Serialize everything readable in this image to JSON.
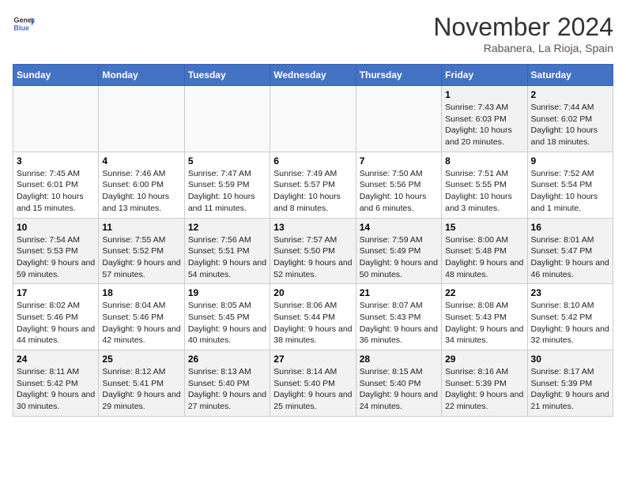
{
  "header": {
    "logo_line1": "General",
    "logo_line2": "Blue",
    "month": "November 2024",
    "location": "Rabanera, La Rioja, Spain"
  },
  "weekdays": [
    "Sunday",
    "Monday",
    "Tuesday",
    "Wednesday",
    "Thursday",
    "Friday",
    "Saturday"
  ],
  "weeks": [
    [
      {
        "day": "",
        "info": ""
      },
      {
        "day": "",
        "info": ""
      },
      {
        "day": "",
        "info": ""
      },
      {
        "day": "",
        "info": ""
      },
      {
        "day": "",
        "info": ""
      },
      {
        "day": "1",
        "info": "Sunrise: 7:43 AM\nSunset: 6:03 PM\nDaylight: 10 hours and 20 minutes."
      },
      {
        "day": "2",
        "info": "Sunrise: 7:44 AM\nSunset: 6:02 PM\nDaylight: 10 hours and 18 minutes."
      }
    ],
    [
      {
        "day": "3",
        "info": "Sunrise: 7:45 AM\nSunset: 6:01 PM\nDaylight: 10 hours and 15 minutes."
      },
      {
        "day": "4",
        "info": "Sunrise: 7:46 AM\nSunset: 6:00 PM\nDaylight: 10 hours and 13 minutes."
      },
      {
        "day": "5",
        "info": "Sunrise: 7:47 AM\nSunset: 5:59 PM\nDaylight: 10 hours and 11 minutes."
      },
      {
        "day": "6",
        "info": "Sunrise: 7:49 AM\nSunset: 5:57 PM\nDaylight: 10 hours and 8 minutes."
      },
      {
        "day": "7",
        "info": "Sunrise: 7:50 AM\nSunset: 5:56 PM\nDaylight: 10 hours and 6 minutes."
      },
      {
        "day": "8",
        "info": "Sunrise: 7:51 AM\nSunset: 5:55 PM\nDaylight: 10 hours and 3 minutes."
      },
      {
        "day": "9",
        "info": "Sunrise: 7:52 AM\nSunset: 5:54 PM\nDaylight: 10 hours and 1 minute."
      }
    ],
    [
      {
        "day": "10",
        "info": "Sunrise: 7:54 AM\nSunset: 5:53 PM\nDaylight: 9 hours and 59 minutes."
      },
      {
        "day": "11",
        "info": "Sunrise: 7:55 AM\nSunset: 5:52 PM\nDaylight: 9 hours and 57 minutes."
      },
      {
        "day": "12",
        "info": "Sunrise: 7:56 AM\nSunset: 5:51 PM\nDaylight: 9 hours and 54 minutes."
      },
      {
        "day": "13",
        "info": "Sunrise: 7:57 AM\nSunset: 5:50 PM\nDaylight: 9 hours and 52 minutes."
      },
      {
        "day": "14",
        "info": "Sunrise: 7:59 AM\nSunset: 5:49 PM\nDaylight: 9 hours and 50 minutes."
      },
      {
        "day": "15",
        "info": "Sunrise: 8:00 AM\nSunset: 5:48 PM\nDaylight: 9 hours and 48 minutes."
      },
      {
        "day": "16",
        "info": "Sunrise: 8:01 AM\nSunset: 5:47 PM\nDaylight: 9 hours and 46 minutes."
      }
    ],
    [
      {
        "day": "17",
        "info": "Sunrise: 8:02 AM\nSunset: 5:46 PM\nDaylight: 9 hours and 44 minutes."
      },
      {
        "day": "18",
        "info": "Sunrise: 8:04 AM\nSunset: 5:46 PM\nDaylight: 9 hours and 42 minutes."
      },
      {
        "day": "19",
        "info": "Sunrise: 8:05 AM\nSunset: 5:45 PM\nDaylight: 9 hours and 40 minutes."
      },
      {
        "day": "20",
        "info": "Sunrise: 8:06 AM\nSunset: 5:44 PM\nDaylight: 9 hours and 38 minutes."
      },
      {
        "day": "21",
        "info": "Sunrise: 8:07 AM\nSunset: 5:43 PM\nDaylight: 9 hours and 36 minutes."
      },
      {
        "day": "22",
        "info": "Sunrise: 8:08 AM\nSunset: 5:43 PM\nDaylight: 9 hours and 34 minutes."
      },
      {
        "day": "23",
        "info": "Sunrise: 8:10 AM\nSunset: 5:42 PM\nDaylight: 9 hours and 32 minutes."
      }
    ],
    [
      {
        "day": "24",
        "info": "Sunrise: 8:11 AM\nSunset: 5:42 PM\nDaylight: 9 hours and 30 minutes."
      },
      {
        "day": "25",
        "info": "Sunrise: 8:12 AM\nSunset: 5:41 PM\nDaylight: 9 hours and 29 minutes."
      },
      {
        "day": "26",
        "info": "Sunrise: 8:13 AM\nSunset: 5:40 PM\nDaylight: 9 hours and 27 minutes."
      },
      {
        "day": "27",
        "info": "Sunrise: 8:14 AM\nSunset: 5:40 PM\nDaylight: 9 hours and 25 minutes."
      },
      {
        "day": "28",
        "info": "Sunrise: 8:15 AM\nSunset: 5:40 PM\nDaylight: 9 hours and 24 minutes."
      },
      {
        "day": "29",
        "info": "Sunrise: 8:16 AM\nSunset: 5:39 PM\nDaylight: 9 hours and 22 minutes."
      },
      {
        "day": "30",
        "info": "Sunrise: 8:17 AM\nSunset: 5:39 PM\nDaylight: 9 hours and 21 minutes."
      }
    ]
  ]
}
